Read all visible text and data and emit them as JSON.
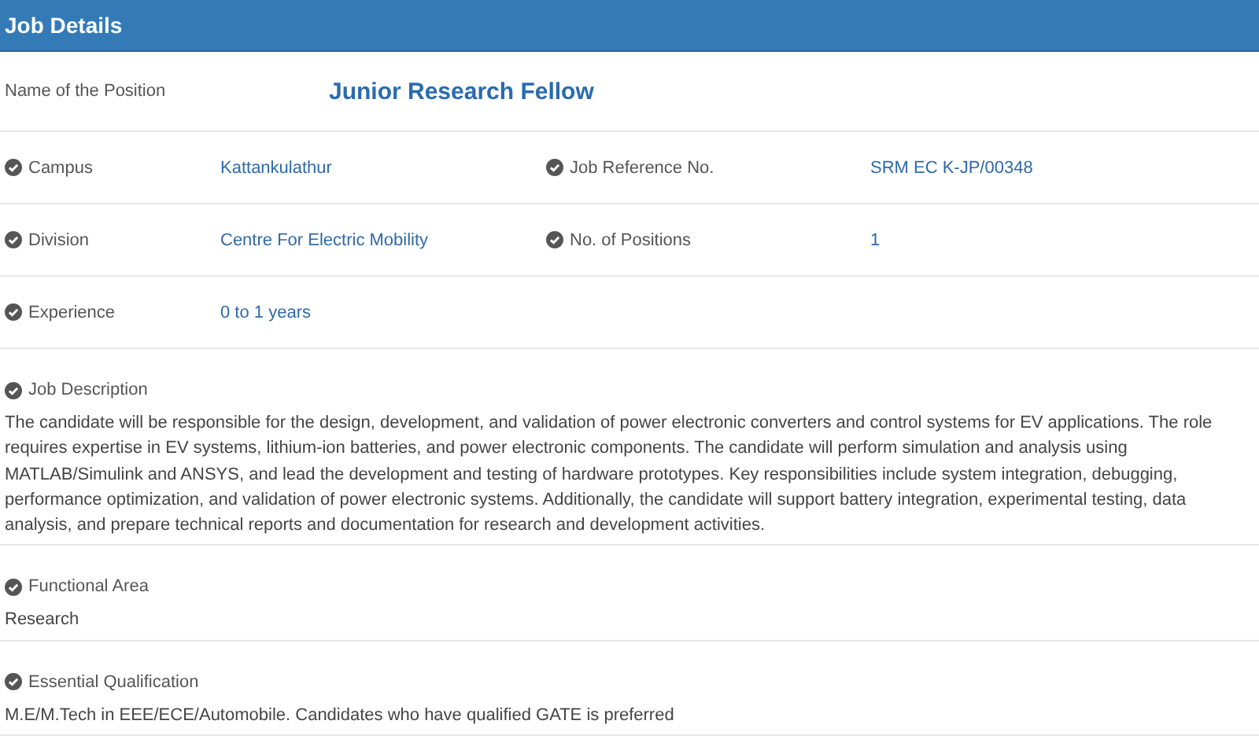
{
  "header": {
    "title": "Job Details"
  },
  "position": {
    "label": "Name of the Position",
    "value": "Junior Research Fellow"
  },
  "details": [
    [
      {
        "label": "Campus",
        "value": "Kattankulathur"
      },
      {
        "label": "Job Reference No.",
        "value": "SRM EC K-JP/00348"
      }
    ],
    [
      {
        "label": "Division",
        "value": "Centre For Electric Mobility"
      },
      {
        "label": "No. of Positions",
        "value": "1"
      }
    ],
    [
      {
        "label": "Experience",
        "value": "0 to 1 years"
      }
    ]
  ],
  "sections": [
    {
      "heading": "Job Description",
      "text": "The candidate will be responsible for the design, development, and validation of power electronic converters and control systems for EV applications. The role requires expertise in EV systems, lithium-ion batteries, and power electronic components. The candidate will perform simulation and analysis using MATLAB/Simulink and ANSYS, and lead the development and testing of hardware prototypes. Key responsibilities include system integration, debugging, performance optimization, and validation of power electronic systems. Additionally, the candidate will support battery integration, experimental testing, data analysis, and prepare technical reports and documentation for research and development activities."
    },
    {
      "heading": "Functional Area",
      "text": "Research"
    },
    {
      "heading": "Essential Qualification",
      "text": "M.E/M.Tech in EEE/ECE/Automobile. Candidates who have qualified GATE is preferred"
    }
  ]
}
